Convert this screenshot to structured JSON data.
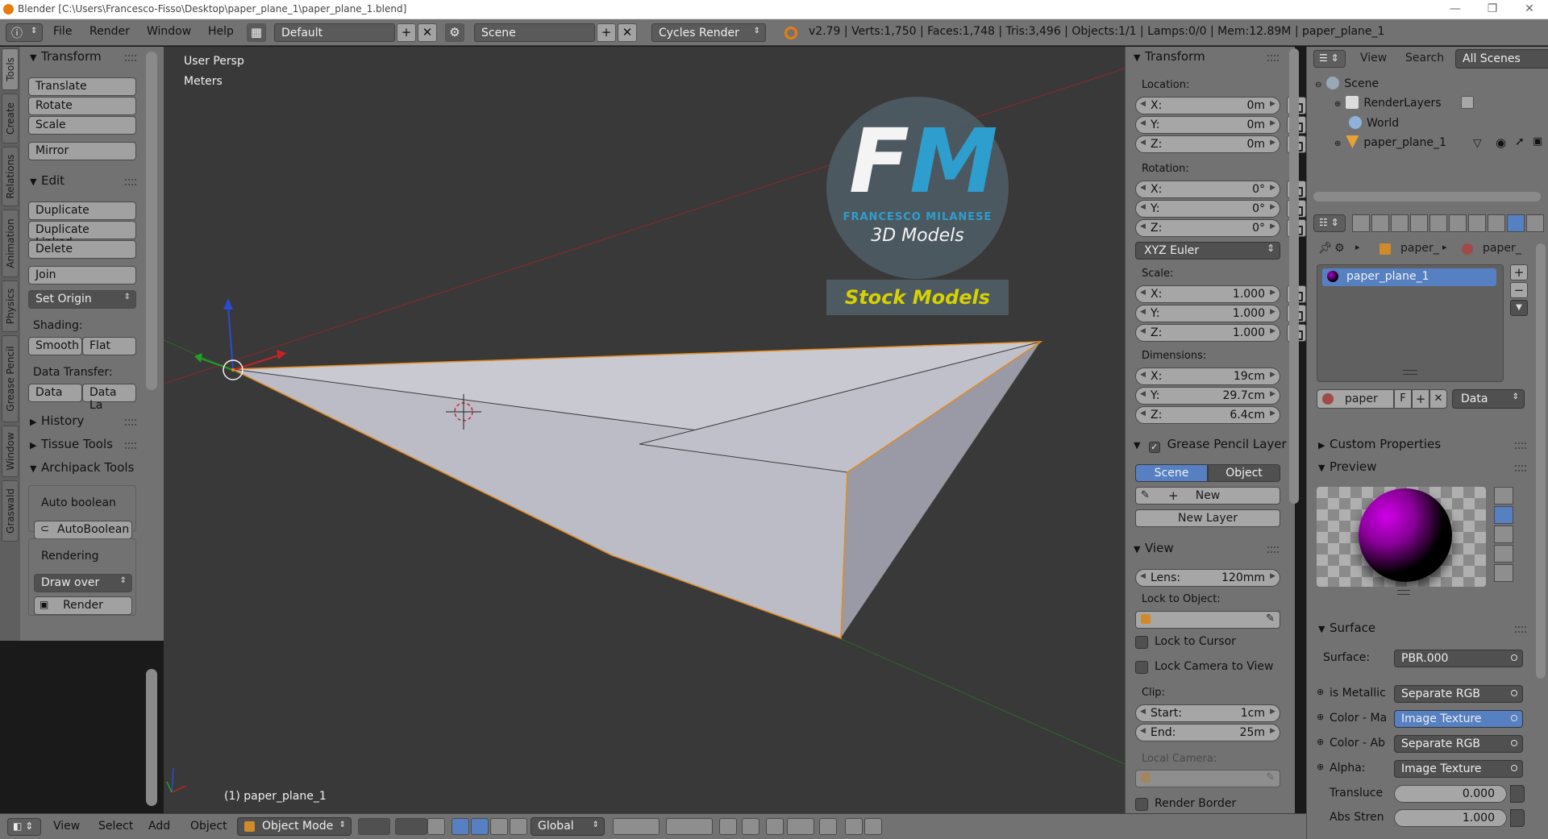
{
  "window": {
    "title": "Blender  [C:\\Users\\Francesco-Fisso\\Desktop\\paper_plane_1\\paper_plane_1.blend]",
    "minimize": "—",
    "maximize": "❐",
    "close": "✕"
  },
  "info_header": {
    "menus": [
      "File",
      "Render",
      "Window",
      "Help"
    ],
    "screen_layout": "Default",
    "scene": "Scene",
    "render_engine": "Cycles Render",
    "stats": "v2.79 | Verts:1,750 | Faces:1,748 | Tris:3,496 | Objects:1/1 | Lamps:0/0 | Mem:12.89M | paper_plane_1"
  },
  "tool_tabs": [
    "Tools",
    "Create",
    "Relations",
    "Animation",
    "Physics",
    "Grease Pencil",
    "Window",
    "Graswald"
  ],
  "tool_shelf": {
    "transform_header": "Transform",
    "translate": "Translate",
    "rotate": "Rotate",
    "scale": "Scale",
    "mirror": "Mirror",
    "edit_header": "Edit",
    "duplicate": "Duplicate",
    "duplicate_linked": "Duplicate Linked",
    "delete": "Delete",
    "join": "Join",
    "set_origin": "Set Origin",
    "shading_label": "Shading:",
    "smooth": "Smooth",
    "flat": "Flat",
    "data_transfer_label": "Data Transfer:",
    "data": "Data",
    "data_layout": "Data La",
    "history": "History",
    "tissue_tools": "Tissue Tools",
    "archipack_tools": "Archipack Tools",
    "auto_boolean_label": "Auto boolean",
    "auto_boolean_btn": "AutoBoolean",
    "rendering_label": "Rendering",
    "draw_over": "Draw over",
    "render": "Render"
  },
  "viewport": {
    "view_name": "User Persp",
    "units": "Meters",
    "object_label": "(1) paper_plane_1",
    "watermark": {
      "monogram_f": "F",
      "monogram_m": "M",
      "company": "FRANCESCO MILANESE",
      "line2": "3D Models",
      "banner": "Stock Models"
    }
  },
  "n_panel": {
    "transform_header": "Transform",
    "location_label": "Location:",
    "location": [
      {
        "axis": "X:",
        "value": "0m"
      },
      {
        "axis": "Y:",
        "value": "0m"
      },
      {
        "axis": "Z:",
        "value": "0m"
      }
    ],
    "rotation_label": "Rotation:",
    "rotation": [
      {
        "axis": "X:",
        "value": "0°"
      },
      {
        "axis": "Y:",
        "value": "0°"
      },
      {
        "axis": "Z:",
        "value": "0°"
      }
    ],
    "rotation_mode": "XYZ Euler",
    "scale_label": "Scale:",
    "scale": [
      {
        "axis": "X:",
        "value": "1.000"
      },
      {
        "axis": "Y:",
        "value": "1.000"
      },
      {
        "axis": "Z:",
        "value": "1.000"
      }
    ],
    "dimensions_label": "Dimensions:",
    "dimensions": [
      {
        "axis": "X:",
        "value": "19cm"
      },
      {
        "axis": "Y:",
        "value": "29.7cm"
      },
      {
        "axis": "Z:",
        "value": "6.4cm"
      }
    ],
    "grease_header": "Grease Pencil Layer",
    "grease_scene": "Scene",
    "grease_object": "Object",
    "grease_new": "New",
    "new_layer": "New Layer",
    "view_header": "View",
    "lens_label": "Lens:",
    "lens_value": "120mm",
    "lock_to_object": "Lock to Object:",
    "lock_to_cursor": "Lock to Cursor",
    "lock_camera": "Lock Camera to View",
    "clip_label": "Clip:",
    "clip_start_label": "Start:",
    "clip_start": "1cm",
    "clip_end_label": "End:",
    "clip_end": "25m",
    "local_camera": "Local Camera:",
    "render_border": "Render Border"
  },
  "outliner": {
    "view": "View",
    "search": "Search",
    "filter": "All Scenes",
    "items": [
      "Scene",
      "RenderLayers",
      "World",
      "paper_plane_1"
    ]
  },
  "properties": {
    "breadcrumb_obj": "paper_",
    "breadcrumb_mat": "paper_",
    "material_slot": "paper_plane_1",
    "material_name": "paper",
    "fake_user": "F",
    "data_link": "Data",
    "custom_props": "Custom Properties",
    "preview": "Preview",
    "surface_header": "Surface",
    "surface_label": "Surface:",
    "surface_value": "PBR.000",
    "rows": [
      {
        "label": "is Metallic",
        "value": "Separate RGB"
      },
      {
        "label": "Color - Ma",
        "value": "Image Texture"
      },
      {
        "label": "Color - Ab",
        "value": "Separate RGB"
      },
      {
        "label": "Alpha:",
        "value": "Image Texture"
      }
    ],
    "translucency_label": "Transluce",
    "translucency_value": "0.000",
    "abs_strength_label": "Abs Stren",
    "abs_strength_value": "1.000"
  },
  "bottom_header": {
    "menus": [
      "View",
      "Select",
      "Add",
      "Object"
    ],
    "mode": "Object Mode",
    "orientation": "Global"
  },
  "colors": {
    "panel_bg": "#727272",
    "viewport_bg": "#393939",
    "selection_blue": "#5680c2",
    "accent_orange": "#e87d0d"
  }
}
